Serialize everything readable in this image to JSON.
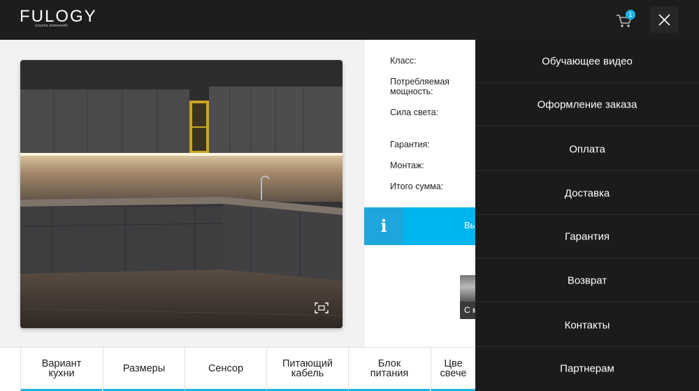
{
  "header": {
    "logo_text": "FULOGY",
    "logo_subtext": "(группа компаний)",
    "cart_count": "1",
    "cart_icon": "cart-icon",
    "close_icon": "close-icon"
  },
  "product": {
    "image_alt": "kitchen-photo",
    "expand_icon": "expand-icon",
    "specs": {
      "class_label": "Класс:",
      "power_label": "Потребляемая\nмощность:",
      "light_label": "Сила света:",
      "warranty_label": "Гарантия:",
      "install_label": "Монтаж:",
      "total_label": "Итого сумма:"
    },
    "info_button": {
      "icon": "i",
      "label": "Вы"
    },
    "thumbnail_label": "С м"
  },
  "tabs": [
    {
      "label": "Вариант\nкухни"
    },
    {
      "label": "Размеры"
    },
    {
      "label": "Сенсор"
    },
    {
      "label": "Питающий\nкабель"
    },
    {
      "label": "Блок\nпитания"
    },
    {
      "label": "Цве\nсвече"
    }
  ],
  "menu": {
    "items": [
      {
        "label": "Обучающее видео"
      },
      {
        "label": "Оформление заказа"
      },
      {
        "label": "Оплата"
      },
      {
        "label": "Доставка"
      },
      {
        "label": "Гарантия"
      },
      {
        "label": "Возврат"
      },
      {
        "label": "Контакты"
      },
      {
        "label": "Партнерам"
      }
    ]
  },
  "colors": {
    "accent": "#1ab3ea",
    "info_bar": "#00b4f0",
    "header_bg": "#1d1d1d",
    "menu_bg": "#1b1b1b"
  }
}
